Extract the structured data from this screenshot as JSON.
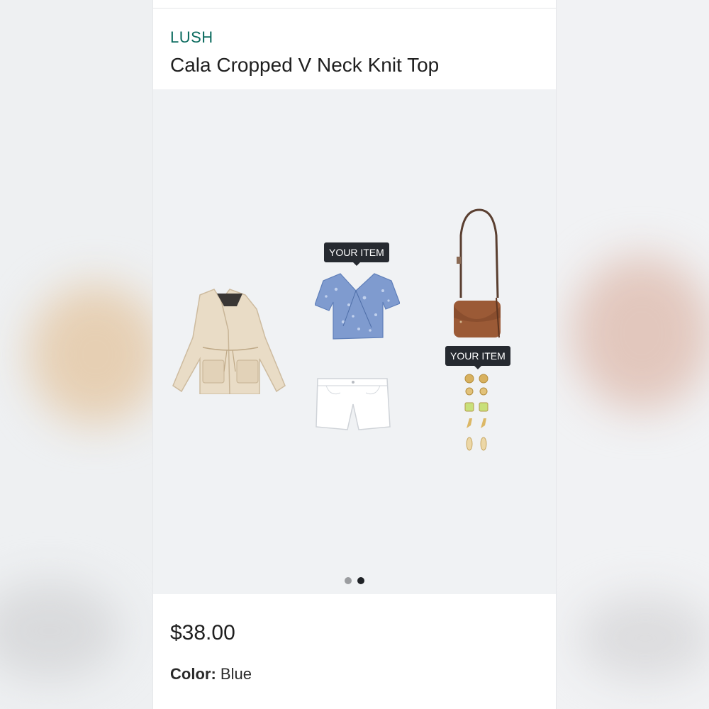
{
  "product": {
    "brand": "LUSH",
    "title": "Cala Cropped V Neck Knit Top",
    "price": "$38.00",
    "color_label": "Color:",
    "color_value": "Blue"
  },
  "gallery": {
    "tags": [
      "YOUR ITEM",
      "YOUR ITEM"
    ],
    "items": [
      "jacket-image",
      "top-image",
      "shorts-image",
      "crossbody-bag-image",
      "earrings-image"
    ],
    "pagination": {
      "total": 2,
      "active": 2
    }
  },
  "colors": {
    "brand": "#0b6b5f",
    "tag_bg": "#262a30",
    "gallery_bg": "#f0f2f4"
  }
}
